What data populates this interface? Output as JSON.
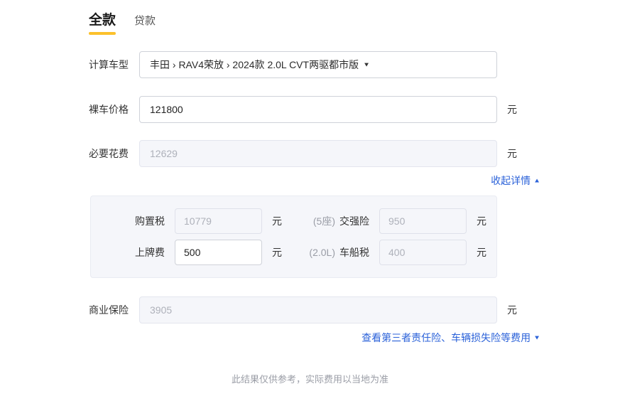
{
  "colors": {
    "accent_yellow": "#fcc12b",
    "link_blue": "#2b62d9",
    "panel_bg": "#f5f6fa"
  },
  "tabs": [
    {
      "label": "全款",
      "active": true
    },
    {
      "label": "贷款",
      "active": false
    }
  ],
  "form": {
    "model": {
      "label": "计算车型",
      "value": "丰田 › RAV4荣放 › 2024款 2.0L CVT两驱都市版",
      "caret": "▼"
    },
    "bare_price": {
      "label": "裸车价格",
      "value": "121800",
      "unit": "元",
      "editable": true
    },
    "required_fees": {
      "label": "必要花费",
      "value": "12629",
      "unit": "元",
      "editable": false
    },
    "commercial_insurance": {
      "label": "商业保险",
      "value": "3905",
      "unit": "元",
      "editable": false
    }
  },
  "links": {
    "collapse_details": {
      "label": "收起详情",
      "caret": "▲"
    },
    "view_more_insurance": {
      "label": "查看第三者责任险、车辆损失险等费用",
      "caret": "▼"
    }
  },
  "panel": {
    "rows": [
      {
        "label": "购置税",
        "value": "10779",
        "unit": "元",
        "editable": false,
        "prefix": "(5座)",
        "label2": "交强险",
        "value2": "950",
        "unit2": "元",
        "editable2": false
      },
      {
        "label": "上牌费",
        "value": "500",
        "unit": "元",
        "editable": true,
        "prefix": "(2.0L)",
        "label2": "车船税",
        "value2": "400",
        "unit2": "元",
        "editable2": false
      }
    ]
  },
  "footer": {
    "note": "此结果仅供参考，实际费用以当地为准"
  }
}
